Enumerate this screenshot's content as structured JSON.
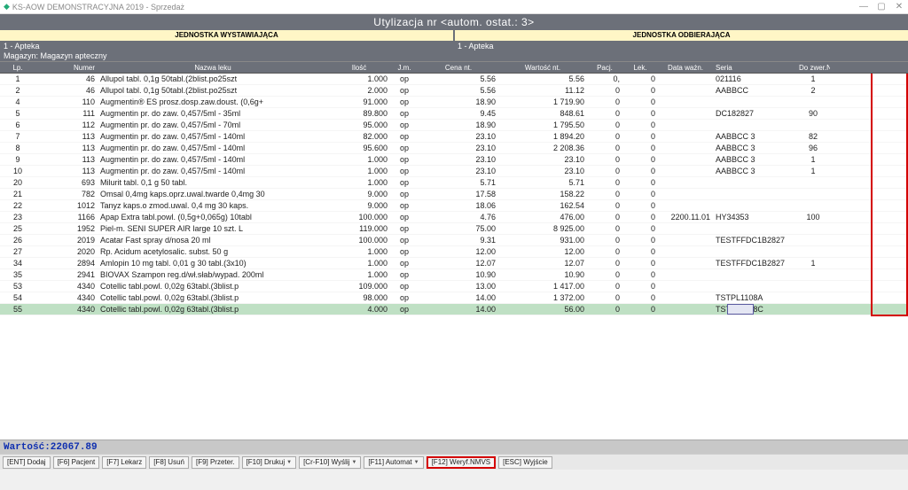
{
  "window": {
    "title": "KS-AOW DEMONSTRACYJNA 2019 - Sprzedaż"
  },
  "header": {
    "title": "Utylizacja nr <autom. ostat.: 3>"
  },
  "units": {
    "left_label": "JEDNOSTKA WYSTAWIAJĄCA",
    "right_label": "JEDNOSTKA ODBIERAJĄCA",
    "left_value": "1 - Apteka",
    "right_value": "1 - Apteka",
    "mag": "Magazyn: Magazyn apteczny"
  },
  "columns": {
    "lp": "Lp.",
    "numer": "Numer",
    "nazwa": "Nazwa leku",
    "ilosc": "Ilość",
    "jm": "J.m.",
    "cena": "Cena nt.",
    "wart": "Wartość nt.",
    "pacj": "Pacj.",
    "lek": "Lek.",
    "data": "Data ważn.",
    "seria": "Seria",
    "zwer": "Do zwer.NMVS"
  },
  "rows": [
    {
      "lp": "1",
      "numer": "46",
      "nazwa": "Allupol tabl. 0,1g 50tabl.(2blist.po25szt",
      "ilosc": "1.000",
      "jm": "op",
      "cena": "5.56",
      "wart": "5.56",
      "pacj": "0,",
      "lek": "0",
      "data": "",
      "seria": "021116",
      "zwer": "1"
    },
    {
      "lp": "2",
      "numer": "46",
      "nazwa": "Allupol tabl. 0,1g 50tabl.(2blist.po25szt",
      "ilosc": "2.000",
      "jm": "op",
      "cena": "5.56",
      "wart": "11.12",
      "pacj": "0",
      "lek": "0",
      "data": "",
      "seria": "AABBCC",
      "zwer": "2"
    },
    {
      "lp": "4",
      "numer": "110",
      "nazwa": "Augmentin® ES prosz.dosp.zaw.doust. (0,6g+",
      "ilosc": "91.000",
      "jm": "op",
      "cena": "18.90",
      "wart": "1 719.90",
      "pacj": "0",
      "lek": "0",
      "data": "",
      "seria": "",
      "zwer": ""
    },
    {
      "lp": "5",
      "numer": "111",
      "nazwa": "Augmentin pr. do zaw. 0,457/5ml - 35ml",
      "ilosc": "89.800",
      "jm": "op",
      "cena": "9.45",
      "wart": "848.61",
      "pacj": "0",
      "lek": "0",
      "data": "",
      "seria": "DC182827",
      "zwer": "90"
    },
    {
      "lp": "6",
      "numer": "112",
      "nazwa": "Augmentin pr. do zaw. 0,457/5ml - 70ml",
      "ilosc": "95.000",
      "jm": "op",
      "cena": "18.90",
      "wart": "1 795.50",
      "pacj": "0",
      "lek": "0",
      "data": "",
      "seria": "",
      "zwer": ""
    },
    {
      "lp": "7",
      "numer": "113",
      "nazwa": "Augmentin pr. do zaw. 0,457/5ml - 140ml",
      "ilosc": "82.000",
      "jm": "op",
      "cena": "23.10",
      "wart": "1 894.20",
      "pacj": "0",
      "lek": "0",
      "data": "",
      "seria": "AABBCC 3",
      "zwer": "82"
    },
    {
      "lp": "8",
      "numer": "113",
      "nazwa": "Augmentin pr. do zaw. 0,457/5ml - 140ml",
      "ilosc": "95.600",
      "jm": "op",
      "cena": "23.10",
      "wart": "2 208.36",
      "pacj": "0",
      "lek": "0",
      "data": "",
      "seria": "AABBCC 3",
      "zwer": "96"
    },
    {
      "lp": "9",
      "numer": "113",
      "nazwa": "Augmentin pr. do zaw. 0,457/5ml - 140ml",
      "ilosc": "1.000",
      "jm": "op",
      "cena": "23.10",
      "wart": "23.10",
      "pacj": "0",
      "lek": "0",
      "data": "",
      "seria": "AABBCC 3",
      "zwer": "1"
    },
    {
      "lp": "10",
      "numer": "113",
      "nazwa": "Augmentin pr. do zaw. 0,457/5ml - 140ml",
      "ilosc": "1.000",
      "jm": "op",
      "cena": "23.10",
      "wart": "23.10",
      "pacj": "0",
      "lek": "0",
      "data": "",
      "seria": "AABBCC 3",
      "zwer": "1"
    },
    {
      "lp": "20",
      "numer": "693",
      "nazwa": "Milurit tabl. 0,1 g 50 tabl.",
      "ilosc": "1.000",
      "jm": "op",
      "cena": "5.71",
      "wart": "5.71",
      "pacj": "0",
      "lek": "0",
      "data": "",
      "seria": "",
      "zwer": ""
    },
    {
      "lp": "21",
      "numer": "782",
      "nazwa": "Omsal 0,4mg kaps.oprz.uwal.twarde 0,4mg 30",
      "ilosc": "9.000",
      "jm": "op",
      "cena": "17.58",
      "wart": "158.22",
      "pacj": "0",
      "lek": "0",
      "data": "",
      "seria": "",
      "zwer": ""
    },
    {
      "lp": "22",
      "numer": "1012",
      "nazwa": "Tanyz kaps.o zmod.uwal. 0,4 mg 30 kaps.",
      "ilosc": "9.000",
      "jm": "op",
      "cena": "18.06",
      "wart": "162.54",
      "pacj": "0",
      "lek": "0",
      "data": "",
      "seria": "",
      "zwer": ""
    },
    {
      "lp": "23",
      "numer": "1166",
      "nazwa": "Apap Extra tabl.powl. (0,5g+0,065g) 10tabl",
      "ilosc": "100.000",
      "jm": "op",
      "cena": "4.76",
      "wart": "476.00",
      "pacj": "0",
      "lek": "0",
      "data": "2200.11.01",
      "seria": "HY34353",
      "zwer": "100"
    },
    {
      "lp": "25",
      "numer": "1952",
      "nazwa": "Piel-m. SENI SUPER AIR large 10 szt. L",
      "ilosc": "119.000",
      "jm": "op",
      "cena": "75.00",
      "wart": "8 925.00",
      "pacj": "0",
      "lek": "0",
      "data": "",
      "seria": "",
      "zwer": ""
    },
    {
      "lp": "26",
      "numer": "2019",
      "nazwa": "Acatar Fast spray d/nosa 20 ml",
      "ilosc": "100.000",
      "jm": "op",
      "cena": "9.31",
      "wart": "931.00",
      "pacj": "0",
      "lek": "0",
      "data": "",
      "seria": "TESTFFDC1B2827",
      "zwer": ""
    },
    {
      "lp": "27",
      "numer": "2020",
      "nazwa": "Rp. Acidum acetylosalic. subst. 50 g",
      "ilosc": "1.000",
      "jm": "op",
      "cena": "12.00",
      "wart": "12.00",
      "pacj": "0",
      "lek": "0",
      "data": "",
      "seria": "",
      "zwer": ""
    },
    {
      "lp": "34",
      "numer": "2894",
      "nazwa": "Amlopin 10 mg tabl. 0,01 g 30 tabl.(3x10)",
      "ilosc": "1.000",
      "jm": "op",
      "cena": "12.07",
      "wart": "12.07",
      "pacj": "0",
      "lek": "0",
      "data": "",
      "seria": "TESTFFDC1B2827",
      "zwer": "1"
    },
    {
      "lp": "35",
      "numer": "2941",
      "nazwa": "BIOVAX Szampon reg.d/wł.słab/wypad. 200ml",
      "ilosc": "1.000",
      "jm": "op",
      "cena": "10.90",
      "wart": "10.90",
      "pacj": "0",
      "lek": "0",
      "data": "",
      "seria": "",
      "zwer": ""
    },
    {
      "lp": "53",
      "numer": "4340",
      "nazwa": "Cotellic tabl.powl. 0,02g 63tabl.(3blist.p",
      "ilosc": "109.000",
      "jm": "op",
      "cena": "13.00",
      "wart": "1 417.00",
      "pacj": "0",
      "lek": "0",
      "data": "",
      "seria": "",
      "zwer": ""
    },
    {
      "lp": "54",
      "numer": "4340",
      "nazwa": "Cotellic tabl.powl. 0,02g 63tabl.(3blist.p",
      "ilosc": "98.000",
      "jm": "op",
      "cena": "14.00",
      "wart": "1 372.00",
      "pacj": "0",
      "lek": "0",
      "data": "",
      "seria": "TSTPL1108A",
      "zwer": ""
    },
    {
      "lp": "55",
      "numer": "4340",
      "nazwa": "Cotellic tabl.powl. 0,02g 63tabl.(3blist.p",
      "ilosc": "4.000",
      "jm": "op",
      "cena": "14.00",
      "wart": "56.00",
      "pacj": "0",
      "lek": "0",
      "data": "",
      "seria": "TSTPL1108C",
      "zwer": "",
      "sel": true
    }
  ],
  "value_label": "Wartość:22067.89",
  "buttons": {
    "ent": "[ENT] Dodaj",
    "f6": "[F6] Pacjent",
    "f7": "[F7] Lekarz",
    "f8": "[F8] Usuń",
    "f9": "[F9] Przeter.",
    "f10": "[F10] Drukuj",
    "cf10": "[Cr-F10] Wyślij",
    "f11": "[F11] Automat",
    "f12": "[F12] Weryf.NMVS",
    "esc": "[ESC] Wyjście"
  }
}
